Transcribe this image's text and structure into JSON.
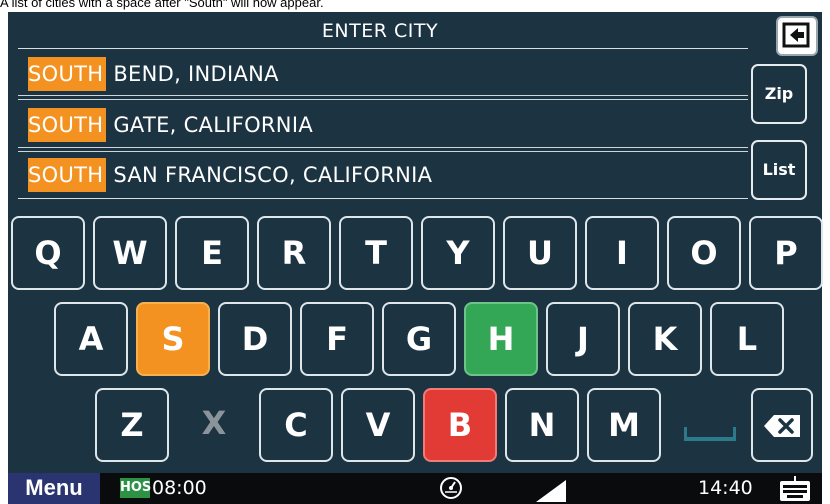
{
  "caption": "A list of cities with a space after \"South\" will now appear.",
  "title": "ENTER CITY",
  "highlight_color": "#f39220",
  "cities": [
    {
      "match": "SOUTH",
      "rest": " BEND, INDIANA"
    },
    {
      "match": "SOUTH",
      "rest": " GATE, CALIFORNIA"
    },
    {
      "match": "SOUTH",
      "rest": " SAN FRANCISCO, CALIFORNIA"
    }
  ],
  "side_buttons": {
    "zip": "Zip",
    "list": "List"
  },
  "keyboard": {
    "row1": [
      "Q",
      "W",
      "E",
      "R",
      "T",
      "Y",
      "U",
      "I",
      "O",
      "P"
    ],
    "row2": [
      "A",
      "S",
      "D",
      "F",
      "G",
      "H",
      "J",
      "K",
      "L"
    ],
    "row3": [
      "Z",
      "X",
      "C",
      "V",
      "B",
      "N",
      "M"
    ]
  },
  "key_colors": {
    "S": "#f39220",
    "H": "#33a755",
    "B": "#e23b36"
  },
  "disabled_keys": [
    "X"
  ],
  "icons": {
    "back": "back-arrow-icon",
    "backspace": "backspace-icon",
    "space": "space-icon",
    "speedometer": "speedometer-icon",
    "signal": "signal-icon",
    "keyboard": "keyboard-icon"
  },
  "status": {
    "menu": "Menu",
    "hos_label": "HOS",
    "hos_time": "08:00",
    "clock": "14:40"
  }
}
